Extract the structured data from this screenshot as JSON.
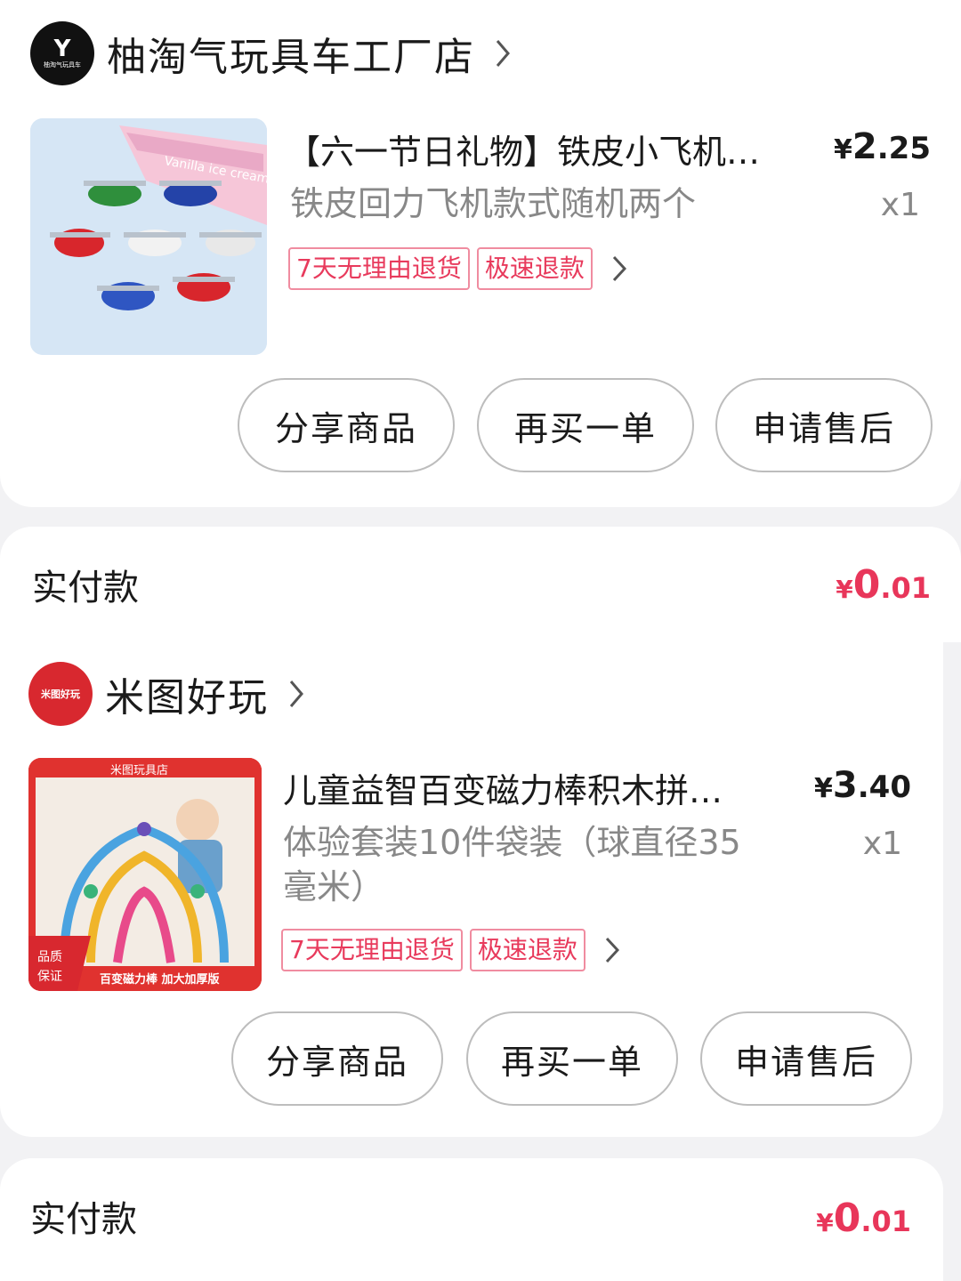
{
  "colors": {
    "accent": "#e8365a",
    "tag_border": "#f08ca0",
    "muted": "#888888"
  },
  "orders": [
    {
      "shop": {
        "name": "柚淘气玩具车工厂店",
        "logo_mark": "Y",
        "logo_text": "柚淘气玩具车"
      },
      "item": {
        "image_text": "Vanilla ice cream",
        "title": "【六一节日礼物】铁皮小飞机…",
        "spec": "铁皮回力飞机款式随机两个",
        "price_currency": "¥",
        "price_int": "2",
        "price_dec": ".25",
        "qty": "x1",
        "tags": [
          "7天无理由退货",
          "极速退款"
        ]
      },
      "buttons": {
        "share": "分享商品",
        "rebuy": "再买一单",
        "aftersale": "申请售后"
      },
      "payment": {
        "label": "实付款",
        "currency": "¥",
        "int": "0",
        "dec": ".01"
      }
    },
    {
      "shop": {
        "name": "米图好玩",
        "logo_text": "米图好玩"
      },
      "item": {
        "image_top": "米图玩具店",
        "image_badge": [
          "品质",
          "保证"
        ],
        "image_bottom": "百变磁力棒 加大加厚版",
        "title": "儿童益智百变磁力棒积木拼…",
        "spec": "体验套装10件袋装（球直径35毫米）",
        "price_currency": "¥",
        "price_int": "3",
        "price_dec": ".40",
        "qty": "x1",
        "tags": [
          "7天无理由退货",
          "极速退款"
        ]
      },
      "buttons": {
        "share": "分享商品",
        "rebuy": "再买一单",
        "aftersale": "申请售后"
      },
      "payment": {
        "label": "实付款",
        "currency": "¥",
        "int": "0",
        "dec": ".01"
      }
    }
  ]
}
